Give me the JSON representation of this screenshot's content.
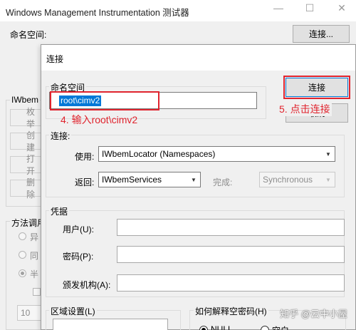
{
  "main_window": {
    "title": "Windows Management Instrumentation 测试器",
    "namespace_label": "命名空间:",
    "connect_button": "连接...",
    "iwbem_group": "IWbem",
    "bg_buttons": [
      "枚举",
      "创建",
      "打开",
      "删除"
    ],
    "method_group": "方法调用",
    "bg_radios": [
      "异",
      "同",
      "半"
    ],
    "bg_count_value": "10",
    "minimize_glyph": "—",
    "maximize_glyph": "☐",
    "close_glyph": "✕"
  },
  "dialog": {
    "title": "连接",
    "namespace_group": "命名空间",
    "namespace_value": "root\\cimv2",
    "connect_button": "连接",
    "cancel_button": "取消",
    "connection_group": "连接:",
    "using_label": "使用:",
    "using_value": "IWbemLocator (Namespaces)",
    "returns_label": "返回:",
    "returns_value": "IWbemServices",
    "completion_label": "完成:",
    "completion_value": "Synchronous",
    "credentials_group": "凭据",
    "user_label": "用户(U):",
    "password_label": "密码(P):",
    "authority_label": "颁发机构(A):",
    "locale_group": "区域设置(L)",
    "password_interpret_group": "如何解释空密码(H)",
    "radio_null": "NULL",
    "radio_empty": "空白"
  },
  "annotations": {
    "step4": "4. 输入root\\cimv2",
    "step5": "5. 点击连接"
  },
  "watermark": "知乎 @云中小屋",
  "colors": {
    "annotation_red": "#e0242e",
    "selection_blue": "#0078d7"
  }
}
